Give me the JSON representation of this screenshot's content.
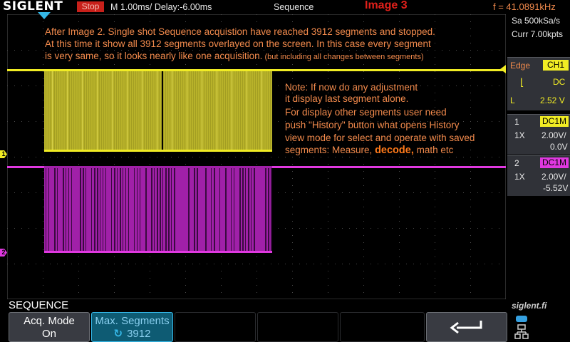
{
  "header": {
    "logo": "SIGLENT",
    "status": "Stop",
    "timebase": "M 1.00ms/ Delay:-6.00ms",
    "mode": "Sequence",
    "image_tag": "Image 3",
    "frequency": "f = 41.0891kHz"
  },
  "acquisition": {
    "sample_rate": "Sa 500kSa/s",
    "memory": "Curr 7.00kpts"
  },
  "trigger": {
    "type": "Edge",
    "source": "CH1",
    "coupling": "DC",
    "level_label": "L",
    "level": "2.52 V"
  },
  "channels": [
    {
      "num": "1",
      "coupling": "DC1M",
      "probe": "1X",
      "scale": "2.00V/",
      "offset": "0.0V",
      "color": "#f1ec24"
    },
    {
      "num": "2",
      "coupling": "DC1M",
      "probe": "1X",
      "scale": "2.00V/",
      "offset": "-5.52V",
      "color": "#e038e0"
    }
  ],
  "markers": {
    "ch1": "1",
    "ch2": "2"
  },
  "notes": {
    "top_1": "After Image 2.  Single shot Sequence acquistion have reached 3912 segments and stopped.",
    "top_2": "At this time it show all 3912 segments overlayed on the screen. In this case every segment",
    "top_3a": "is very same, so it looks nearly like one acquisition.",
    "top_3b": "  (but including all changes between segments)",
    "right_1": "Note: If now do any adjustment",
    "right_2": "it display last segment alone.",
    "right_3": "For display other segments user need",
    "right_4": "push \"History\" button what opens History",
    "right_5": "view mode for select and operate with saved",
    "right_6a": "segments: Measure, ",
    "right_6b": "decode,",
    "right_6c": " math etc"
  },
  "menu": {
    "title": "SEQUENCE",
    "watermark": "siglent.fi",
    "acq_mode_label": "Acq. Mode",
    "acq_mode_value": "On",
    "max_segments_label": "Max. Segments",
    "max_segments_value": "3912",
    "back_icon": "return-arrow-icon"
  },
  "colors": {
    "ch1": "#f1ec24",
    "ch2": "#e038e0",
    "annotation": "#f28a4c",
    "accent": "#35b8e8",
    "stop": "#c8201a"
  }
}
